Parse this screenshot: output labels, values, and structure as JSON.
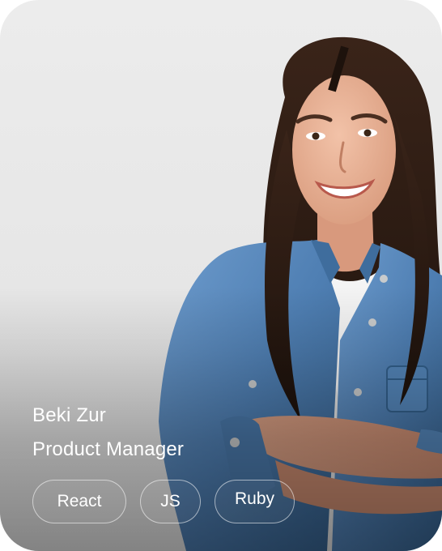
{
  "profile": {
    "name": "Beki Zur",
    "role": "Product Manager"
  },
  "tags": [
    "React",
    "JS",
    "Ruby"
  ],
  "colors": {
    "background": "#e7e7e7",
    "text": "#ffffff",
    "denim": "#4f7fb3",
    "hair": "#2b1a12",
    "skin": "#e8b196"
  }
}
